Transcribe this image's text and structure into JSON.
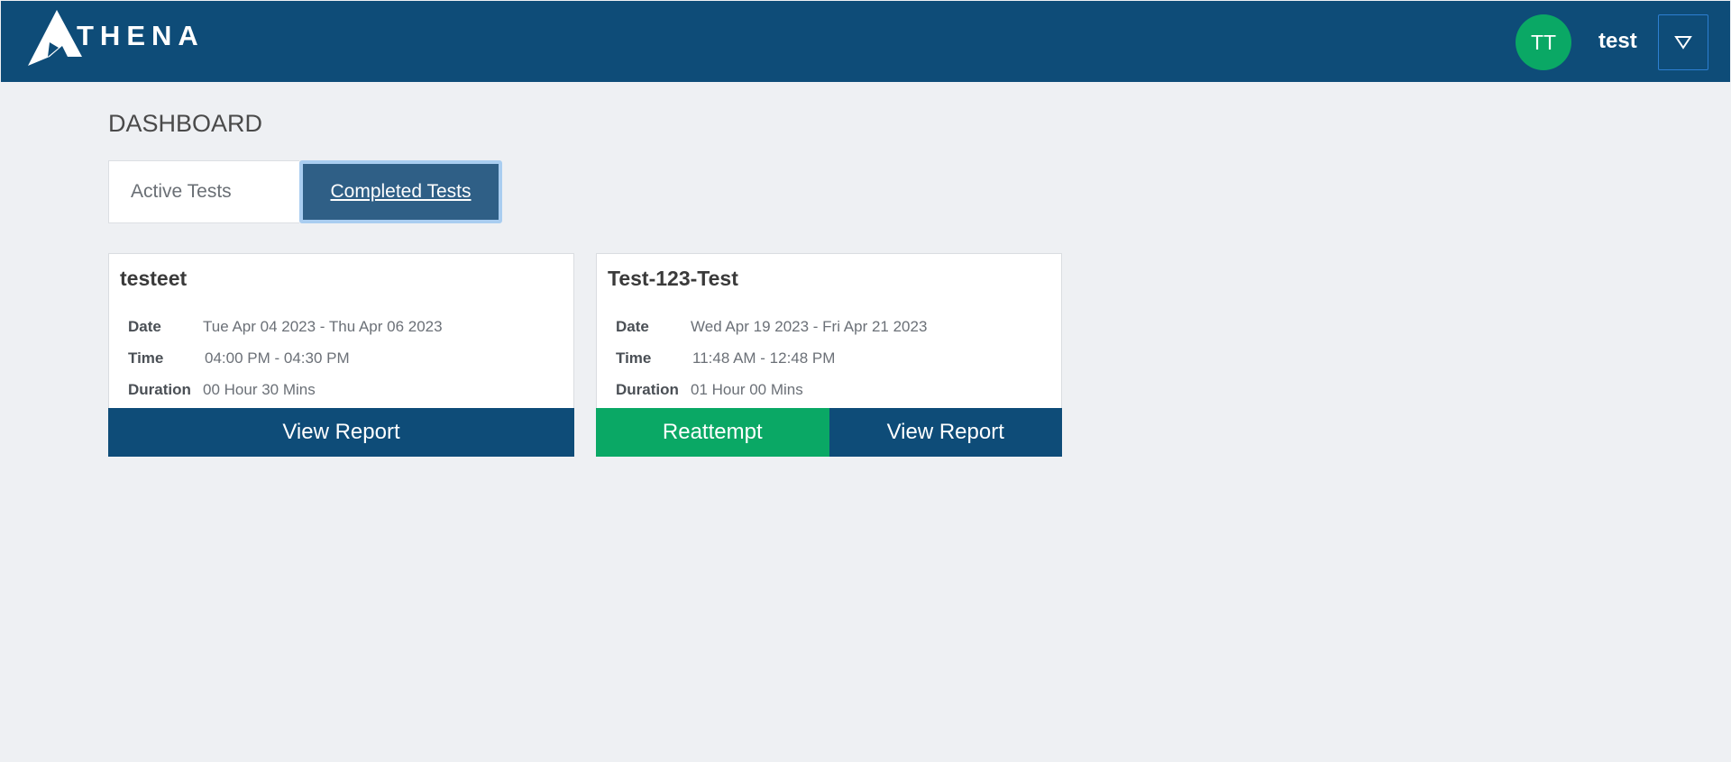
{
  "header": {
    "brand": "THENA",
    "avatar_initials": "TT",
    "username": "test",
    "colors": {
      "bar": "#0e4c78",
      "avatar": "#0aa865"
    }
  },
  "page": {
    "title": "DASHBOARD"
  },
  "tabs": [
    {
      "label": "Active Tests",
      "selected": false
    },
    {
      "label": "Completed Tests",
      "selected": true
    }
  ],
  "cards": [
    {
      "title": "testeet",
      "date_label": "Date",
      "date_value": "Tue Apr 04 2023 - Thu Apr 06 2023",
      "time_label": "Time",
      "time_value": "04:00 PM - 04:30 PM",
      "duration_label": "Duration",
      "duration_value": "00 Hour 30 Mins",
      "view_report_label": "View Report"
    },
    {
      "title": "Test-123-Test",
      "date_label": "Date",
      "date_value": "Wed Apr 19 2023 - Fri Apr 21 2023",
      "time_label": "Time",
      "time_value": "11:48 AM - 12:48 PM",
      "duration_label": "Duration",
      "duration_value": "01 Hour 00 Mins",
      "reattempt_label": "Reattempt",
      "view_report_label": "View Report"
    }
  ]
}
